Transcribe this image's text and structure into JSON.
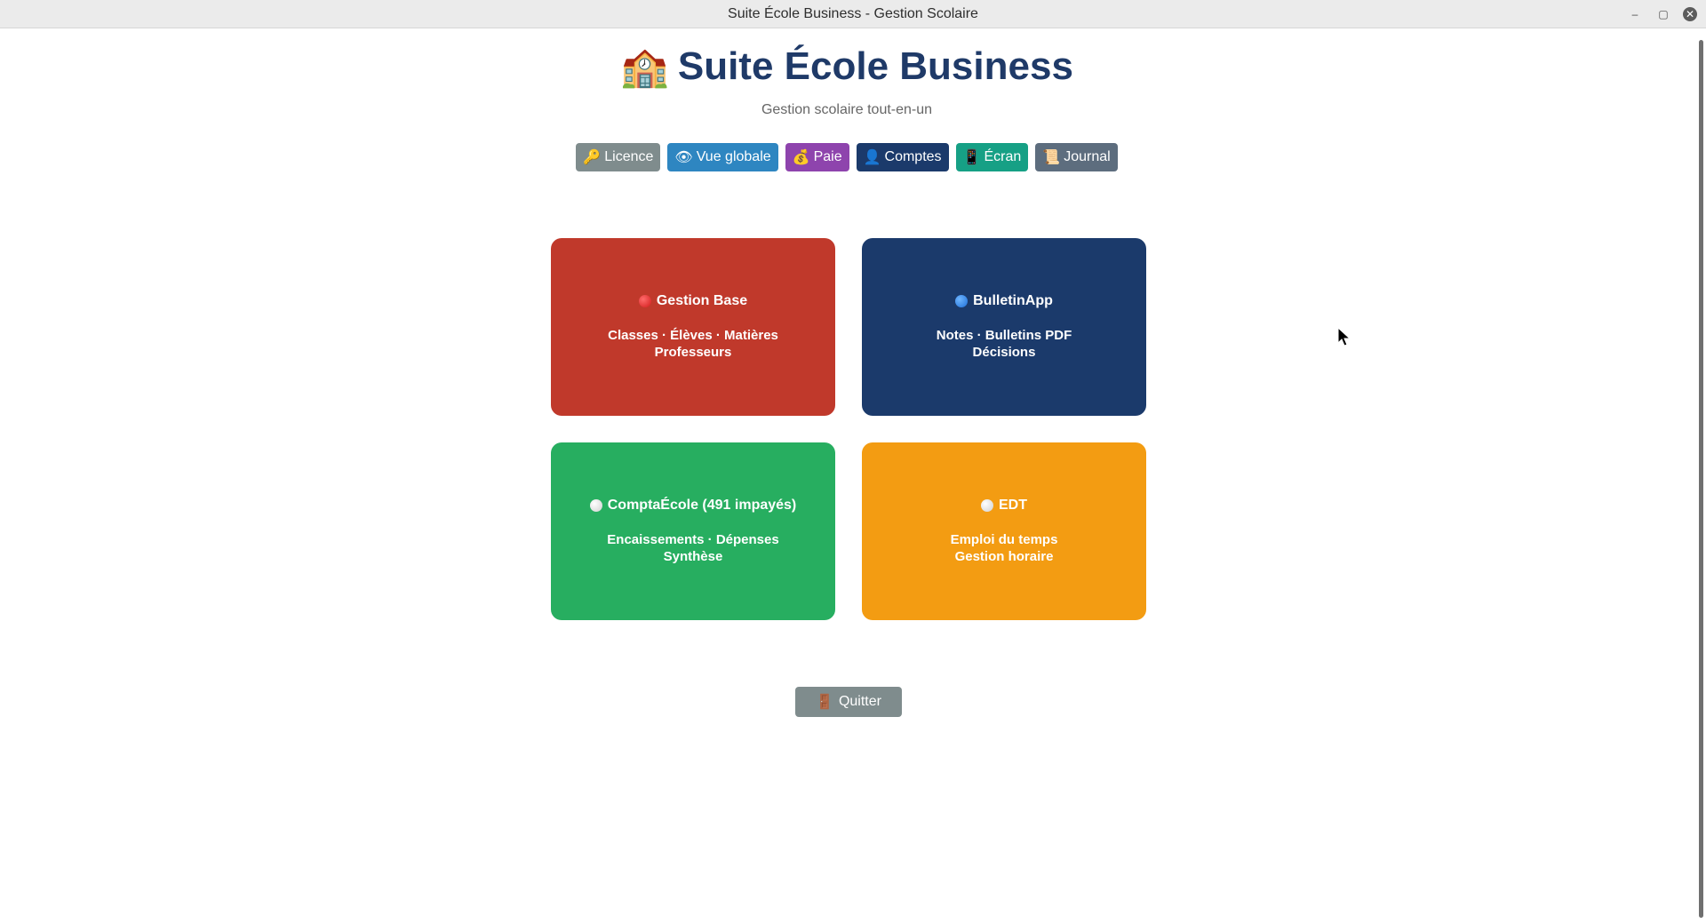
{
  "window": {
    "title": "Suite École Business - Gestion Scolaire",
    "minimize": "–",
    "maximize": "▢",
    "close": "✕"
  },
  "header": {
    "icon": "🏫",
    "title": "Suite École Business",
    "subtitle": "Gestion scolaire tout-en-un"
  },
  "toolbar": {
    "licence": {
      "icon": "🔑",
      "label": "Licence"
    },
    "vue_globale": {
      "icon": "👁",
      "label": "Vue globale"
    },
    "paie": {
      "icon": "💰",
      "label": "Paie"
    },
    "comptes": {
      "icon": "👤",
      "label": "Comptes"
    },
    "ecran": {
      "icon": "📱",
      "label": "Écran"
    },
    "journal": {
      "icon": "📜",
      "label": "Journal"
    }
  },
  "modules": {
    "gestion_base": {
      "title": "Gestion Base",
      "line1": "Classes · Élèves · Matières",
      "line2": "Professeurs",
      "color": "#c0392b"
    },
    "bulletin": {
      "title": "BulletinApp",
      "line1": "Notes · Bulletins PDF",
      "line2": "Décisions",
      "color": "#1b3a6b"
    },
    "compta": {
      "title": "ComptaÉcole (491 impayés)",
      "line1": "Encaissements · Dépenses",
      "line2": "Synthèse",
      "color": "#27ae60"
    },
    "edt": {
      "title": "EDT",
      "line1": "Emploi du temps",
      "line2": "Gestion horaire",
      "color": "#f39c12"
    }
  },
  "quit": {
    "icon": "🚪",
    "label": "Quitter"
  }
}
